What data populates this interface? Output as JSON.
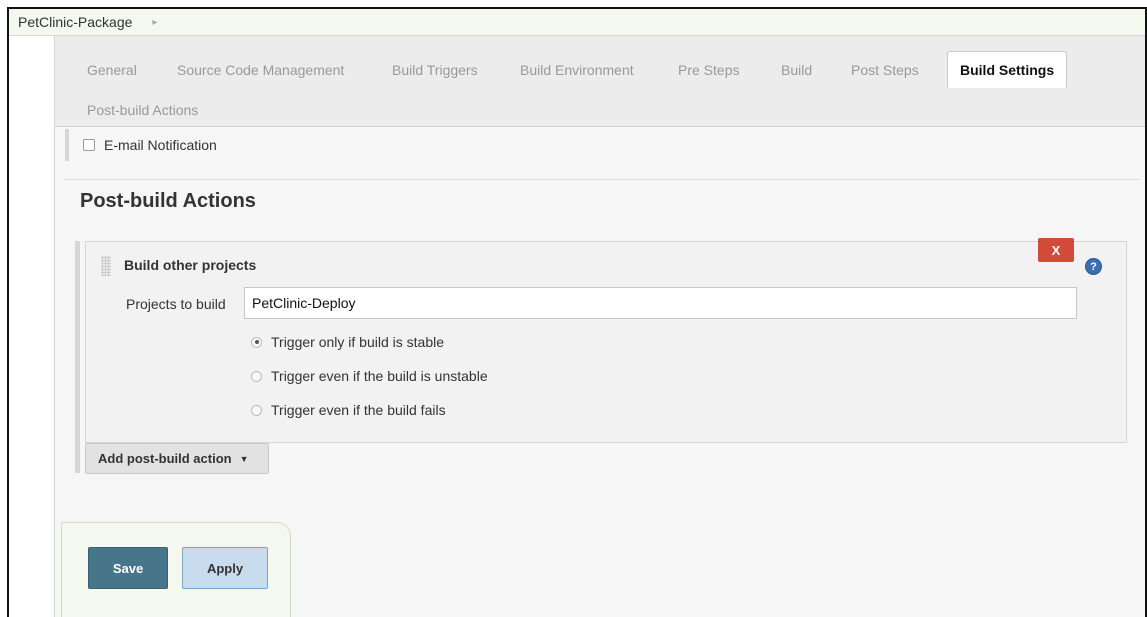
{
  "breadcrumb": {
    "project": "PetClinic-Package",
    "separator": "▸"
  },
  "tabs": [
    {
      "label": "General"
    },
    {
      "label": "Source Code Management"
    },
    {
      "label": "Build Triggers"
    },
    {
      "label": "Build Environment"
    },
    {
      "label": "Pre Steps"
    },
    {
      "label": "Build"
    },
    {
      "label": "Post Steps"
    },
    {
      "label": "Build Settings",
      "active": true
    },
    {
      "label": "Post-build Actions"
    }
  ],
  "email_notification": {
    "label": "E-mail Notification",
    "checked": false
  },
  "post_build": {
    "title": "Post-build Actions",
    "block": {
      "title": "Build other projects",
      "delete_label": "X",
      "help_label": "?",
      "projects_label": "Projects to build",
      "projects_value": "PetClinic-Deploy",
      "options": [
        {
          "label": "Trigger only if build is stable",
          "selected": true
        },
        {
          "label": "Trigger even if the build is unstable",
          "selected": false
        },
        {
          "label": "Trigger even if the build fails",
          "selected": false
        }
      ]
    },
    "add_action_label": "Add post-build action",
    "add_action_caret": "▼"
  },
  "buttons": {
    "save": "Save",
    "apply": "Apply"
  },
  "colors": {
    "save_bg": "#47768a",
    "apply_bg": "#c9dcee",
    "delete_bg": "#d24a3a",
    "help_bg": "#3a6fb0",
    "breadcrumb_bg": "#f4f8ee"
  }
}
